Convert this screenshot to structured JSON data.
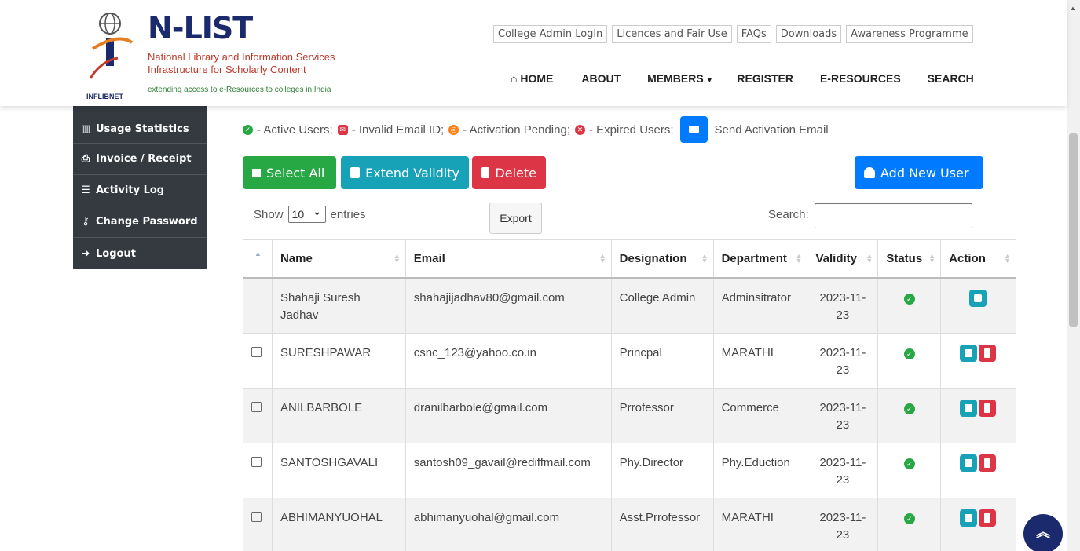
{
  "logo": {
    "title": "N-LIST",
    "line1": "National Library and Information Services",
    "line2": "Infrastructure for Scholarly Content",
    "line3": "extending access to e-Resources to colleges in India",
    "org": "INFLIBNET"
  },
  "toplinks": [
    "College Admin Login",
    "Licences and Fair Use",
    "FAQs",
    "Downloads",
    "Awareness Programme"
  ],
  "nav": {
    "home": "HOME",
    "about": "ABOUT",
    "members": "MEMBERS",
    "register": "REGISTER",
    "eresources": "E-RESOURCES",
    "search": "SEARCH"
  },
  "sidebar": {
    "items": [
      {
        "label": "Usage Statistics",
        "icon": "bar-chart-icon"
      },
      {
        "label": "Invoice / Receipt",
        "icon": "print-icon"
      },
      {
        "label": "Activity Log",
        "icon": "list-icon"
      },
      {
        "label": "Change Password",
        "icon": "key-icon"
      },
      {
        "label": "Logout",
        "icon": "sign-out-icon"
      }
    ]
  },
  "legend": {
    "active": "- Active Users;",
    "invalid": "- Invalid Email ID;",
    "pending": "- Activation Pending;",
    "expired": "- Expired Users;",
    "send": "Send Activation Email"
  },
  "toolbar": {
    "select_all": "Select All",
    "extend": "Extend Validity",
    "delete": "Delete",
    "add": "Add New User"
  },
  "controls": {
    "show": "Show",
    "entries_value": "10",
    "entries": "entries",
    "export": "Export",
    "search": "Search:"
  },
  "table": {
    "headers": [
      "Name",
      "Email",
      "Designation",
      "Department",
      "Validity",
      "Status",
      "Action"
    ],
    "rows": [
      {
        "name": "Shahaji Suresh Jadhav",
        "email": "shahajijadhav80@gmail.com",
        "designation": "College Admin",
        "department": "Adminsitrator",
        "validity": "2023-11-23"
      },
      {
        "name": "SURESHPAWAR",
        "email": "csnc_123@yahoo.co.in",
        "designation": "Princpal",
        "department": "MARATHI",
        "validity": "2023-11-23"
      },
      {
        "name": "ANILBARBOLE",
        "email": "dranilbarbole@gmail.com",
        "designation": "Prrofessor",
        "department": "Commerce",
        "validity": "2023-11-23"
      },
      {
        "name": "SANTOSHGAVALI",
        "email": "santosh09_gavail@rediffmail.com",
        "designation": "Phy.Director",
        "department": "Phy.Eduction",
        "validity": "2023-11-23"
      },
      {
        "name": "ABHIMANYUOHAL",
        "email": "abhimanyuohal@gmail.com",
        "designation": "Asst.Prrofessor",
        "department": "MARATHI",
        "validity": "2023-11-23"
      }
    ]
  },
  "colors": {
    "green": "#28a745",
    "teal": "#17a2b8",
    "red": "#dc3545",
    "blue": "#007bff",
    "orange": "#fd7e14",
    "sidebar": "#343a40"
  }
}
